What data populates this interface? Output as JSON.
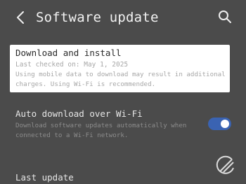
{
  "header": {
    "title": "Software update",
    "back_icon": "chevron-left-icon",
    "search_icon": "search-icon"
  },
  "download_install": {
    "title": "Download and install",
    "last_checked": "Last checked on: May 1, 2025",
    "note": "Using mobile data to download may result in additional charges. Using Wi-Fi is recommended."
  },
  "auto_download": {
    "title": "Auto download over Wi-Fi",
    "description": "Download software updates automatically when connected to a Wi-Fi network.",
    "enabled": true
  },
  "last_update": {
    "title": "Last update"
  },
  "colors": {
    "background": "#4b4b4b",
    "highlight": "#ffffff",
    "toggle_on": "#3a63b2"
  },
  "watermark_icon": "watermark-logo-icon"
}
